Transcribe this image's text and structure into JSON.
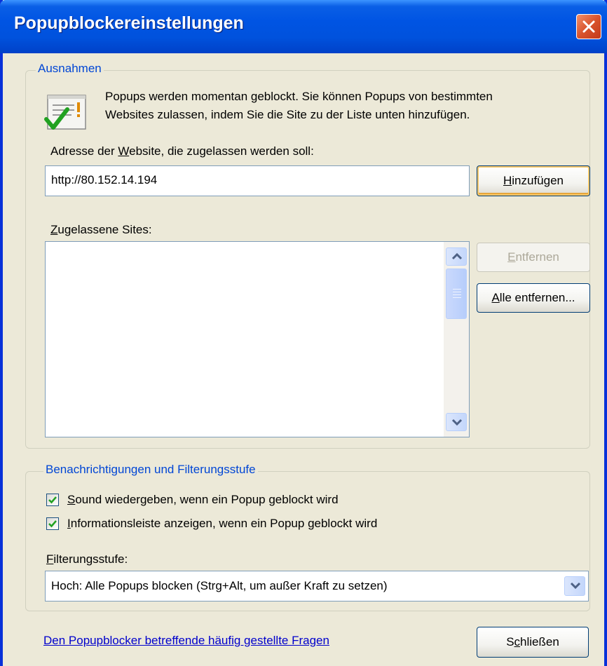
{
  "window": {
    "title": "Popupblockereinstellungen"
  },
  "exceptions": {
    "legend": "Ausnahmen",
    "info_line1": "Popups werden momentan geblockt. Sie können Popups von bestimmten",
    "info_line2": "Websites zulassen, indem Sie die Site zu der Liste unten hinzufügen.",
    "address_label_pre": "Adresse der ",
    "address_label_key": "W",
    "address_label_post": "ebsite, die zugelassen werden soll:",
    "address_value": "http://80.152.14.194",
    "add_key": "H",
    "add_rest": "inzufügen",
    "allowed_label_key": "Z",
    "allowed_label_rest": "ugelassene Sites:",
    "allowed_sites": [],
    "remove_key": "E",
    "remove_rest": "ntfernen",
    "remove_all_key": "A",
    "remove_all_rest": "lle entfernen..."
  },
  "notifications": {
    "legend": "Benachrichtigungen und Filterungsstufe",
    "sound_key": "S",
    "sound_rest": "ound wiedergeben, wenn ein Popup geblockt wird",
    "sound_checked": true,
    "infobar_key": "I",
    "infobar_rest": "nformationsleiste anzeigen, wenn ein Popup geblockt wird",
    "infobar_checked": true,
    "filter_label_key": "F",
    "filter_label_rest": "ilterungsstufe:",
    "filter_selected": "Hoch: Alle Popups blocken (Strg+Alt, um außer Kraft zu setzen)"
  },
  "footer": {
    "faq_link": "Den Popupblocker betreffende häufig gestellte Fragen",
    "close_pre": "S",
    "close_key": "c",
    "close_rest": "hließen"
  },
  "icons": {
    "title_close": "close-icon",
    "info": "popup-blocked-info-icon",
    "scroll_up": "chevron-up-icon",
    "scroll_down": "chevron-down-icon",
    "dropdown": "chevron-down-icon",
    "check": "check-icon"
  },
  "colors": {
    "titlebar": "#0054e3",
    "legend_text": "#0046d5",
    "link": "#0000cc",
    "check": "#21a121"
  }
}
